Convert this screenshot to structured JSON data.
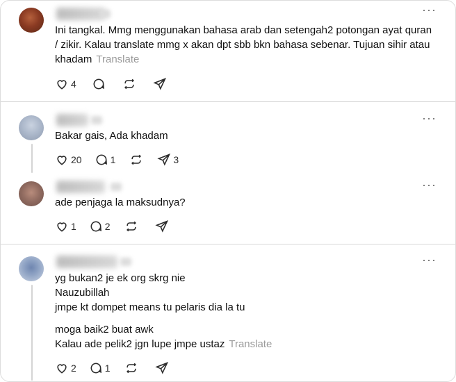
{
  "posts": [
    {
      "username": "",
      "lines": [
        "Ini tangkal. Mmg menggunakan bahasa arab dan setengah2 potongan ayat quran",
        "/ zikir. Kalau translate mmg x akan dpt sbb bkn bahasa sebenar. Tujuan sihir atau",
        "khadam"
      ],
      "translate_label": "Translate",
      "likes": "4",
      "replies": "",
      "reposts": "",
      "shares": ""
    },
    {
      "username": "",
      "lines": [
        "Bakar gais, Ada khadam"
      ],
      "likes": "20",
      "replies": "1",
      "reposts": "",
      "shares": "3"
    },
    {
      "username": "",
      "lines": [
        "ade penjaga la maksudnya?"
      ],
      "likes": "1",
      "replies": "2",
      "reposts": "",
      "shares": ""
    },
    {
      "username": "",
      "lines": [
        "yg bukan2 je ek org skrg nie",
        "Nauzubillah",
        "jmpe kt dompet means tu pelaris dia la tu"
      ],
      "lines2": [
        "moga baik2 buat awk",
        "Kalau ade pelik2 jgn lupe jmpe ustaz"
      ],
      "translate_label": "Translate",
      "likes": "2",
      "replies": "1",
      "reposts": "",
      "shares": ""
    }
  ],
  "more_glyph": "···",
  "icons": [
    "heart-icon",
    "comment-icon",
    "repost-icon",
    "share-icon",
    "more-icon"
  ]
}
